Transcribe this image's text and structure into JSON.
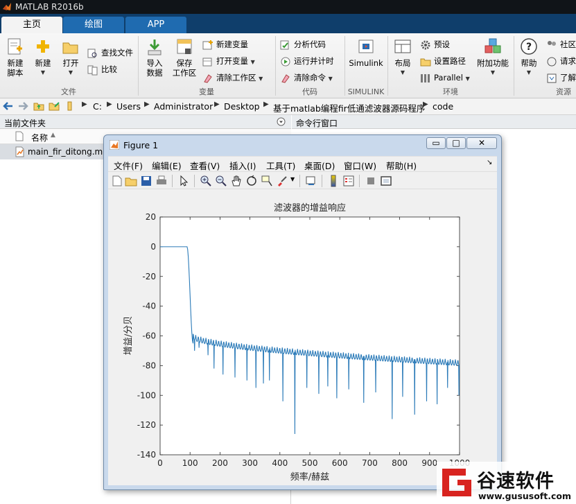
{
  "app": {
    "title": "MATLAB R2016b"
  },
  "ribbon_tabs": [
    {
      "label": "主页",
      "active": true
    },
    {
      "label": "绘图",
      "active": false
    },
    {
      "label": "APP",
      "active": false
    }
  ],
  "ribbon": {
    "new_script": [
      "新建",
      "脚本"
    ],
    "new": "新建",
    "open": "打开",
    "find_files": "查找文件",
    "compare": "比较",
    "import": [
      "导入",
      "数据"
    ],
    "save_ws": [
      "保存",
      "工作区"
    ],
    "new_var": "新建变量",
    "open_var": "打开变量",
    "clear_ws": "清除工作区",
    "analyze": "分析代码",
    "run_time": "运行并计时",
    "clear_cmd": "清除命令",
    "simulink": "Simulink",
    "layout": "布局",
    "preferences": "预设",
    "set_path": "设置路径",
    "parallel": "Parallel",
    "addons": "附加功能",
    "help": "帮助",
    "community": "社区",
    "request": "请求",
    "learn": "了解",
    "groups": {
      "file": "文件",
      "variable": "变量",
      "code": "代码",
      "simulink": "SIMULINK",
      "environment": "环境",
      "resources": "资源"
    }
  },
  "address": {
    "crumbs": [
      "C:",
      "Users",
      "Administrator",
      "Desktop",
      "基于matlab编程fir低通滤波器源码程序",
      "code"
    ]
  },
  "current_folder": {
    "title": "当前文件夹",
    "column_name": "名称",
    "files": [
      "main_fir_ditong.m"
    ]
  },
  "command_window": {
    "title": "命令行窗口"
  },
  "figure": {
    "title": "Figure 1",
    "menu": [
      "文件(F)",
      "编辑(E)",
      "查看(V)",
      "插入(I)",
      "工具(T)",
      "桌面(D)",
      "窗口(W)",
      "帮助(H)"
    ],
    "minimize": "▭",
    "maximize": "□",
    "close": "✕",
    "menu_arrow": "↘"
  },
  "chart_data": {
    "type": "line",
    "title": "滤波器的增益响应",
    "xlabel": "频率/赫兹",
    "ylabel": "增益/分贝",
    "xlim": [
      0,
      1000
    ],
    "ylim": [
      -140,
      20
    ],
    "xticks": [
      0,
      100,
      200,
      300,
      400,
      500,
      600,
      700,
      800,
      900,
      1000
    ],
    "yticks": [
      20,
      0,
      -20,
      -40,
      -60,
      -80,
      -100,
      -120,
      -140
    ],
    "series_color": "#2a7ab8",
    "passband": {
      "x": [
        0,
        90
      ],
      "gain": 0
    },
    "transition": {
      "x": [
        90,
        110
      ],
      "gain": [
        0,
        -65
      ]
    },
    "stopband_envelope": {
      "x": [
        110,
        1000
      ],
      "gain": [
        -58,
        -76
      ]
    },
    "stopband_nulls": [
      [
        115,
        -70
      ],
      [
        130,
        -68
      ],
      [
        160,
        -73
      ],
      [
        180,
        -82
      ],
      [
        210,
        -86
      ],
      [
        250,
        -88
      ],
      [
        290,
        -90
      ],
      [
        320,
        -95
      ],
      [
        345,
        -92
      ],
      [
        365,
        -90
      ],
      [
        410,
        -104
      ],
      [
        450,
        -126
      ],
      [
        490,
        -95
      ],
      [
        530,
        -99
      ],
      [
        560,
        -94
      ],
      [
        590,
        -102
      ],
      [
        630,
        -96
      ],
      [
        680,
        -105
      ],
      [
        720,
        -98
      ],
      [
        775,
        -116
      ],
      [
        810,
        -101
      ],
      [
        850,
        -113
      ],
      [
        890,
        -104
      ],
      [
        925,
        -106
      ],
      [
        960,
        -95
      ],
      [
        998,
        -100
      ]
    ]
  },
  "watermark": {
    "brand": "谷速软件",
    "url": "www.gususoft.com",
    "accent": "#d8231f"
  }
}
